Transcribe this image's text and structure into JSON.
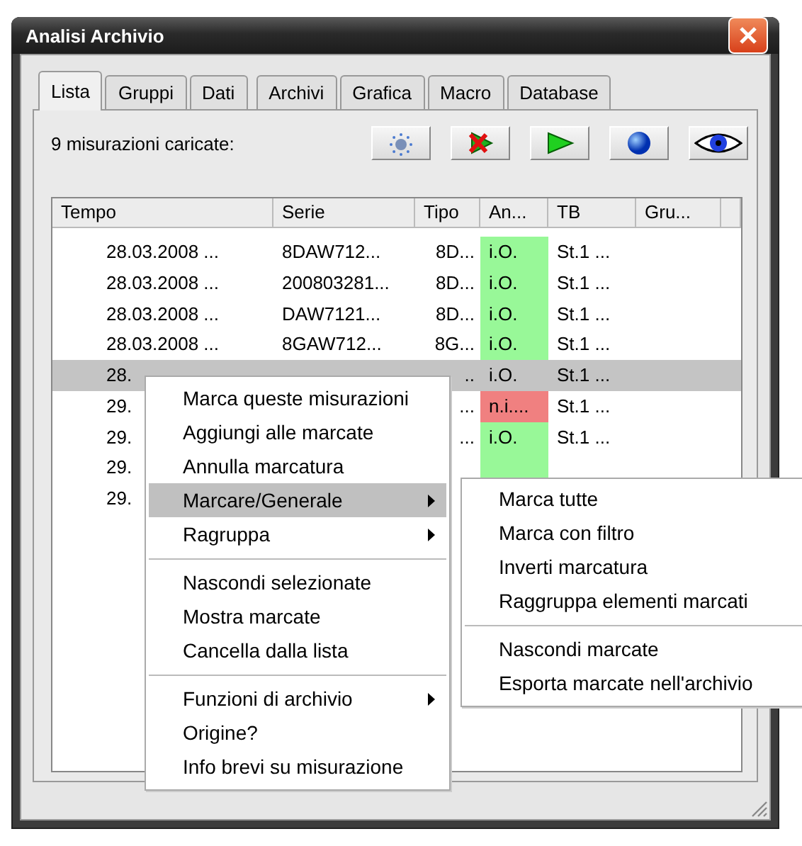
{
  "window": {
    "title": "Analisi Archivio"
  },
  "tabs": [
    {
      "label": "Lista",
      "selected": true
    },
    {
      "label": "Gruppi",
      "selected": false
    },
    {
      "label": "Dati",
      "selected": false
    },
    {
      "label": "Archivi",
      "selected": false
    },
    {
      "label": "Grafica",
      "selected": false
    },
    {
      "label": "Macro",
      "selected": false
    },
    {
      "label": "Database",
      "selected": false
    }
  ],
  "toolbar": {
    "label": "9 misurazioni caricate:",
    "buttons": [
      {
        "kind": "sparkle"
      },
      {
        "kind": "stop"
      },
      {
        "kind": "play"
      },
      {
        "kind": "globe"
      },
      {
        "kind": "eye"
      }
    ]
  },
  "table": {
    "columns": [
      "Tempo",
      "Serie",
      "Tipo",
      "An...",
      "TB",
      "Gru..."
    ],
    "rows": [
      {
        "tempo": "28.03.2008 ...",
        "serie": "8DAW712...",
        "tipo": "8D...",
        "an": "i.O.",
        "color": "#98f898",
        "tb": "St.1 ...",
        "selected": false
      },
      {
        "tempo": "28.03.2008 ...",
        "serie": "200803281...",
        "tipo": "8D...",
        "an": "i.O.",
        "color": "#98f898",
        "tb": "St.1 ...",
        "selected": false
      },
      {
        "tempo": "28.03.2008 ...",
        "serie": "DAW7121...",
        "tipo": "8D...",
        "an": "i.O.",
        "color": "#98f898",
        "tb": "St.1 ...",
        "selected": false
      },
      {
        "tempo": "28.03.2008 ...",
        "serie": "8GAW712...",
        "tipo": "8G...",
        "an": "i.O.",
        "color": "#98f898",
        "tb": "St.1 ...",
        "selected": false
      },
      {
        "tempo": "28.",
        "tipo": "..",
        "an": "i.O.",
        "tb": "St.1 ...",
        "selected": true
      },
      {
        "tempo": "29.",
        "tipo": "...",
        "an": "n.i....",
        "color": "#f08080",
        "tb": "St.1 ...",
        "selected": false
      },
      {
        "tempo": "29.",
        "tipo": "...",
        "an": "i.O.",
        "color": "#98f898",
        "tb": "St.1 ...",
        "selected": false
      },
      {
        "tempo": "29.",
        "color": "#98f898",
        "selected": false
      },
      {
        "tempo": "29.",
        "selected": false
      }
    ]
  },
  "context_menu": {
    "items": [
      {
        "kind": "item",
        "label": "Marca queste misurazioni",
        "submenu": false,
        "selected": false
      },
      {
        "kind": "item",
        "label": "Aggiungi alle marcate",
        "submenu": false,
        "selected": false
      },
      {
        "kind": "item",
        "label": "Annulla marcatura",
        "submenu": false,
        "selected": false
      },
      {
        "kind": "item",
        "label": "Marcare/Generale",
        "submenu": true,
        "selected": true
      },
      {
        "kind": "item",
        "label": "Ragruppa",
        "submenu": true,
        "selected": false
      },
      {
        "kind": "separator"
      },
      {
        "kind": "item",
        "label": "Nascondi selezionate",
        "submenu": false,
        "selected": false
      },
      {
        "kind": "item",
        "label": "Mostra marcate",
        "submenu": false,
        "selected": false
      },
      {
        "kind": "item",
        "label": "Cancella dalla lista",
        "submenu": false,
        "selected": false
      },
      {
        "kind": "separator"
      },
      {
        "kind": "item",
        "label": "Funzioni di archivio",
        "submenu": true,
        "selected": false
      },
      {
        "kind": "item",
        "label": "Origine?",
        "submenu": false,
        "selected": false
      },
      {
        "kind": "item",
        "label": "Info brevi su misurazione",
        "submenu": false,
        "selected": false
      }
    ]
  },
  "submenu": {
    "items": [
      {
        "kind": "item",
        "label": "Marca tutte"
      },
      {
        "kind": "item",
        "label": "Marca con filtro"
      },
      {
        "kind": "item",
        "label": "Inverti marcatura"
      },
      {
        "kind": "item",
        "label": "Raggruppa elementi marcati"
      },
      {
        "kind": "separator"
      },
      {
        "kind": "item",
        "label": "Nascondi marcate"
      },
      {
        "kind": "item",
        "label": "Esporta marcate nell'archivio"
      }
    ]
  }
}
